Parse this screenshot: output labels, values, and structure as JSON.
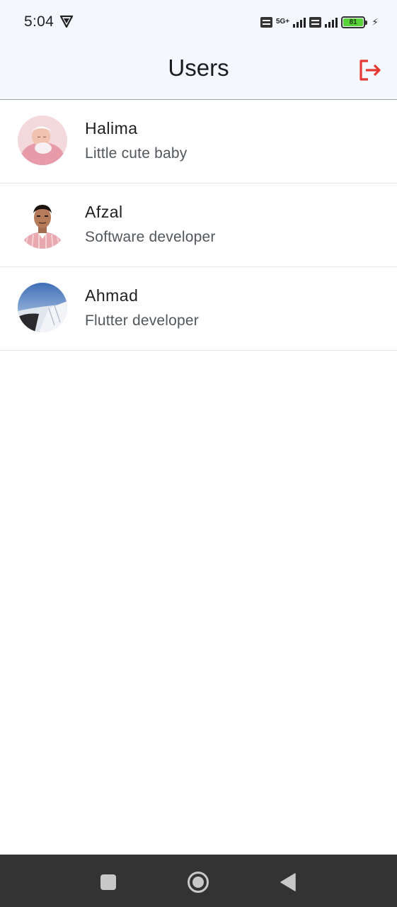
{
  "status_bar": {
    "time": "5:04",
    "network_1": "5G+",
    "battery_level": "81"
  },
  "app_bar": {
    "title": "Users",
    "logout_icon": "logout-icon",
    "accent_color": "#e53935"
  },
  "users": [
    {
      "name": "Halima",
      "subtitle": "Little cute baby",
      "avatar": "baby-photo"
    },
    {
      "name": "Afzal",
      "subtitle": "Software developer",
      "avatar": "man-portrait-photo"
    },
    {
      "name": "Ahmad",
      "subtitle": "Flutter developer",
      "avatar": "airplane-window-photo"
    }
  ],
  "nav_bar": {
    "recents_icon": "square-icon",
    "home_icon": "circle-icon",
    "back_icon": "triangle-back-icon"
  }
}
